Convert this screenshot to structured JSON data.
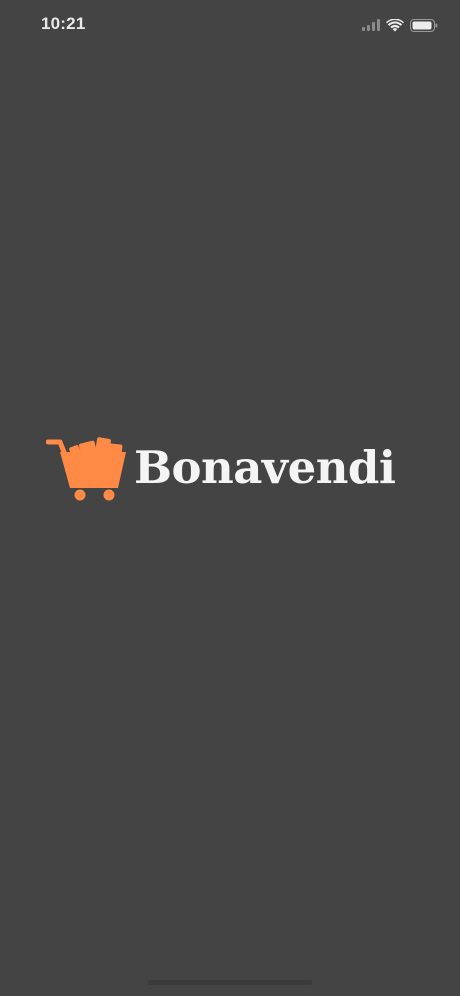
{
  "status_bar": {
    "time": "10:21",
    "icons": [
      "cellular-signal-icon",
      "wifi-icon",
      "battery-icon"
    ]
  },
  "splash": {
    "brand_name": "Bonavendi",
    "logo_icon": "shopping-cart-icon",
    "background_color": "#444444",
    "brand_color": "#ff8a45",
    "text_color": "#f4f4f4"
  }
}
